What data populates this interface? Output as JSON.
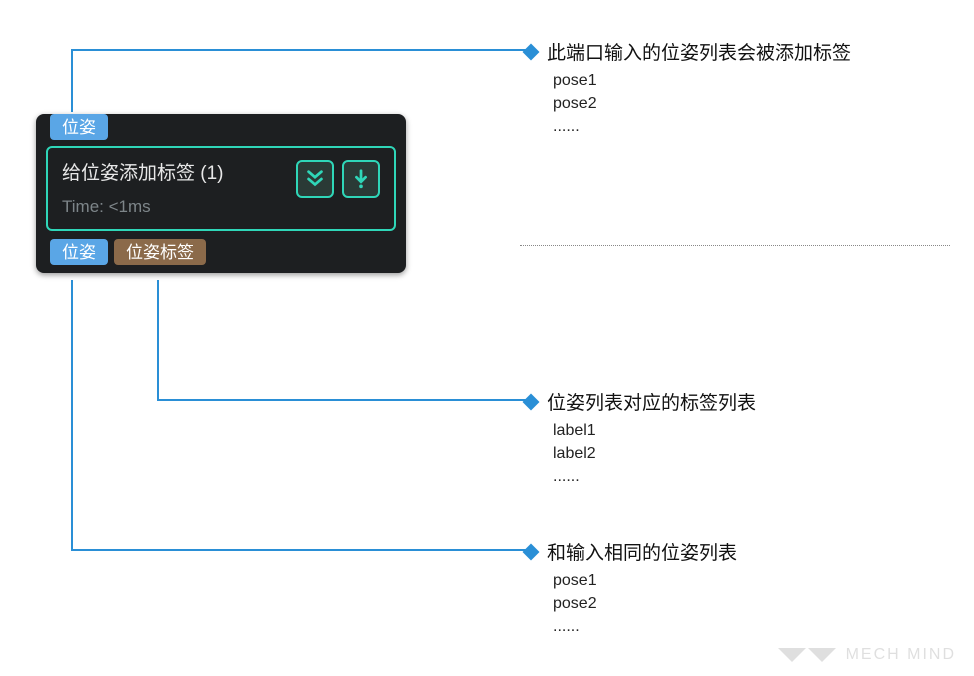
{
  "node": {
    "input_tag": "位姿",
    "title": "给位姿添加标签 (1)",
    "time": "Time: <1ms",
    "output_tag_pose": "位姿",
    "output_tag_label": "位姿标签",
    "icon1_name": "double-down-icon",
    "icon2_name": "down-dot-icon"
  },
  "annotations": {
    "input": {
      "title": "此端口输入的位姿列表会被添加标签",
      "example": "pose1\npose2\n......"
    },
    "output_label": {
      "title": "位姿列表对应的标签列表",
      "example": "label1\nlabel2\n......"
    },
    "output_pose": {
      "title": "和输入相同的位姿列表",
      "example": "pose1\npose2\n......"
    }
  },
  "watermark": "MECH MIND"
}
